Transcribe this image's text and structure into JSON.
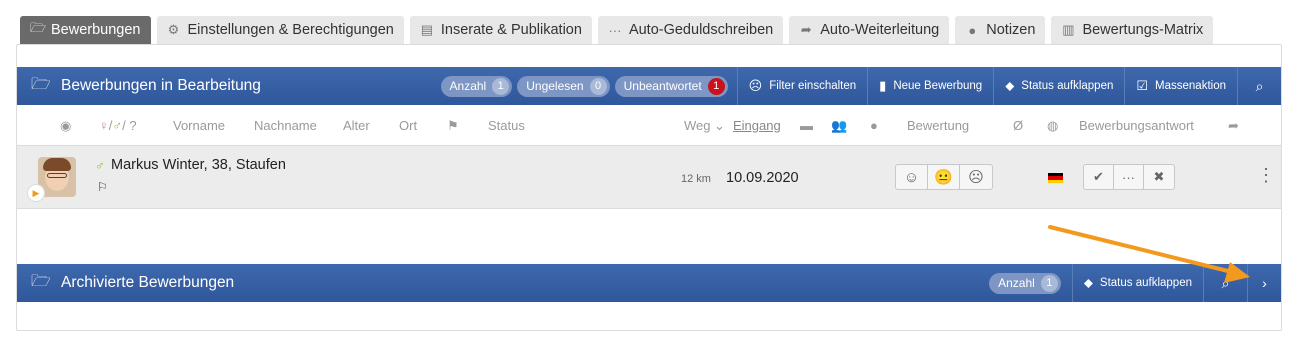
{
  "tabs": [
    {
      "label": "Bewerbungen",
      "icon": "folder-open-icon",
      "active": true
    },
    {
      "label": "Einstellungen & Berechtigungen",
      "icon": "gears-icon",
      "active": false
    },
    {
      "label": "Inserate & Publikation",
      "icon": "list-icon",
      "active": false
    },
    {
      "label": "Auto-Geduldschreiben",
      "icon": "ellipsis-icon",
      "active": false
    },
    {
      "label": "Auto-Weiterleitung",
      "icon": "share-icon",
      "active": false
    },
    {
      "label": "Notizen",
      "icon": "comment-icon",
      "active": false
    },
    {
      "label": "Bewertungs-Matrix",
      "icon": "bar-chart-icon",
      "active": false
    }
  ],
  "active_section": {
    "title": "Bewerbungen in Bearbeitung",
    "badges": [
      {
        "label": "Anzahl",
        "count": "1",
        "alert": false
      },
      {
        "label": "Ungelesen",
        "count": "0",
        "alert": false
      },
      {
        "label": "Unbeantwortet",
        "count": "1",
        "alert": true
      }
    ],
    "actions": [
      {
        "label": "Filter einschalten",
        "icon": "frown-icon"
      },
      {
        "label": "Neue Bewerbung",
        "icon": "file-icon"
      },
      {
        "label": "Status aufklappen",
        "icon": "tag-icon"
      },
      {
        "label": "Massenaktion",
        "icon": "checkbox-icon"
      }
    ]
  },
  "columns": {
    "gender": "/ / ?",
    "firstname": "Vorname",
    "lastname": "Nachname",
    "age": "Alter",
    "place": "Ort",
    "status": "Status",
    "way": "Weg",
    "received": "Eingang",
    "rating": "Bewertung",
    "avg": "Ø",
    "answer": "Bewerbungsantwort"
  },
  "applicant": {
    "name": "Markus Winter, 38, Staufen",
    "distance": "12 km",
    "date": "10.09.2020",
    "ratings": [
      "☺",
      "😐",
      "☹"
    ],
    "answers": [
      "✔",
      "···",
      "✖"
    ]
  },
  "archive_section": {
    "title": "Archivierte Bewerbungen",
    "badge": {
      "label": "Anzahl",
      "count": "1"
    },
    "action": {
      "label": "Status aufklappen",
      "icon": "tag-icon"
    }
  },
  "colors": {
    "bar_blue": "#2f579b",
    "alert_red": "#c9121e",
    "arrow_orange": "#f39a1e",
    "tab_active": "#6a6a6a"
  }
}
